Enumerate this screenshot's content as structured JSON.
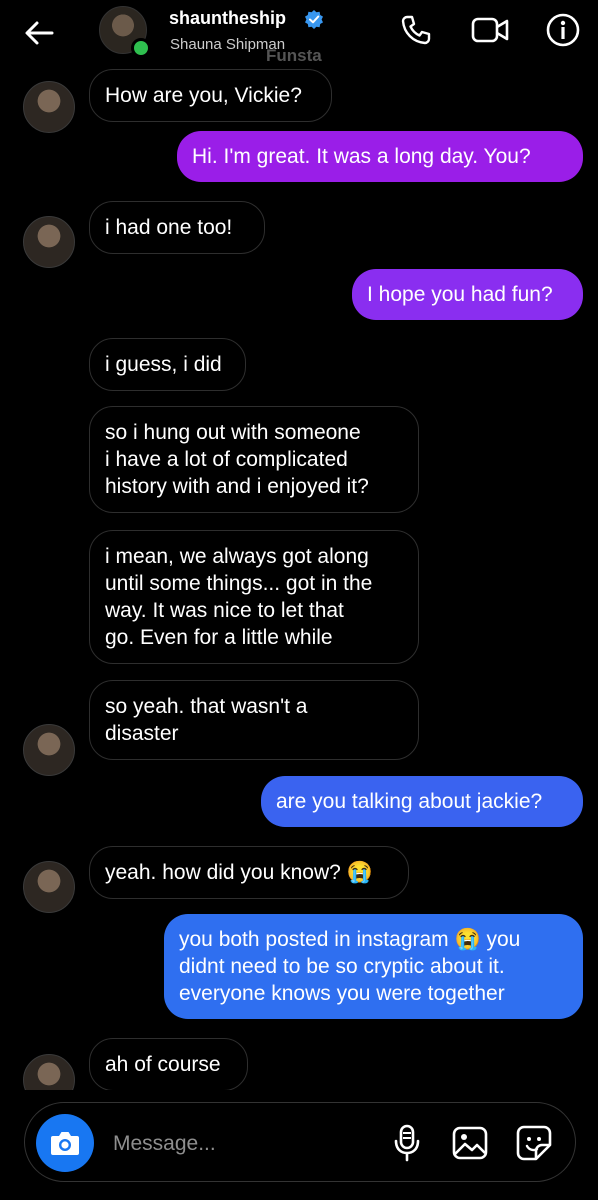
{
  "header": {
    "username": "shauntheship",
    "full_name": "Shauna Shipman",
    "watermark": "Funsta",
    "icons": [
      "back-arrow-icon",
      "avatar",
      "verified-badge-icon",
      "phone-icon",
      "video-camera-icon",
      "info-icon"
    ]
  },
  "messages": [
    {
      "from": "them",
      "text": "How are you, Vickie?"
    },
    {
      "from": "me",
      "text": "Hi. I'm great. It was a long day.  You?"
    },
    {
      "from": "them",
      "text": "i had one too!"
    },
    {
      "from": "me",
      "text": "I hope you had fun?"
    },
    {
      "from": "them",
      "text": "i guess, i did"
    },
    {
      "from": "them",
      "text": "so i hung out with someone\ni have a lot of complicated\nhistory with and i enjoyed it?"
    },
    {
      "from": "them",
      "text": "i mean, we always got along\nuntil some things... got in the\nway. It was nice to let that\ngo. Even for a little while"
    },
    {
      "from": "them",
      "text": "so yeah. that wasn't a\ndisaster"
    },
    {
      "from": "me",
      "text": "are you talking about jackie?"
    },
    {
      "from": "them",
      "text": "yeah. how did you know? 😭"
    },
    {
      "from": "me",
      "text": "you both posted in instagram 😭 you\ndidnt need to be so cryptic about it.\neveryone knows you were together"
    },
    {
      "from": "them",
      "text": "ah of course"
    }
  ],
  "composer": {
    "placeholder": "Message...",
    "icons": [
      "camera-icon",
      "microphone-icon",
      "gallery-icon",
      "sticker-icon"
    ]
  },
  "colors": {
    "background": "#000000",
    "incoming_border": "#2e2e2e",
    "outgoing_purple": "#9a1ee8",
    "outgoing_blue": "#3a63f0",
    "camera_button": "#1877f2",
    "online_dot": "#2fbf4f",
    "verified": "#3897f0"
  }
}
